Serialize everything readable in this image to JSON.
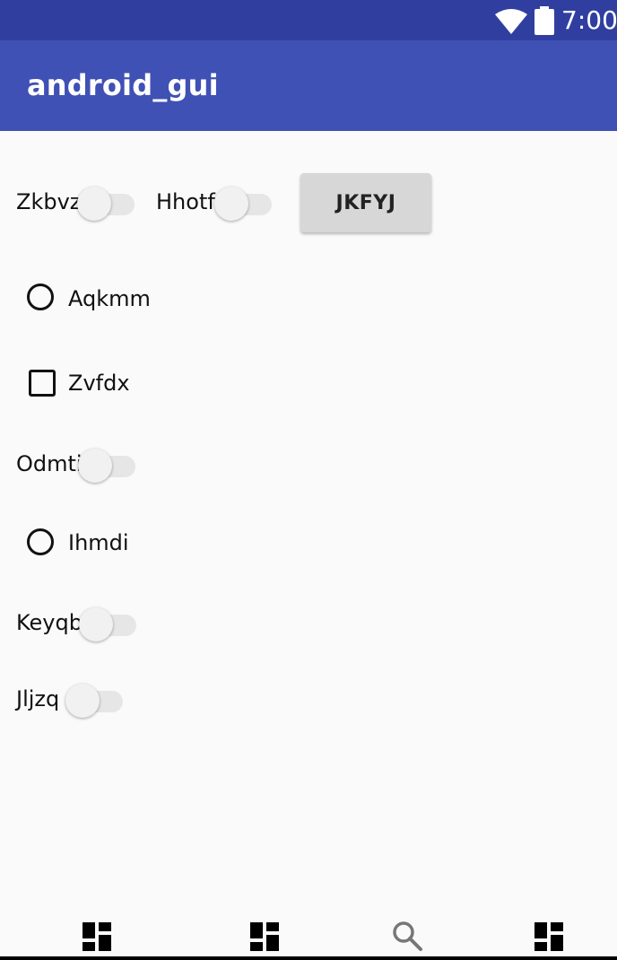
{
  "status_bar": {
    "time": "7:00",
    "icons": [
      "wifi-icon",
      "battery-icon"
    ]
  },
  "app_bar": {
    "title": "android_gui"
  },
  "controls": {
    "switch_zkbvz": {
      "label": "Zkbvz",
      "checked": false
    },
    "switch_hhotf": {
      "label": "Hhotf",
      "checked": false
    },
    "button_jkfyj": {
      "label": "JKFYJ"
    },
    "radio_aqkmm": {
      "label": "Aqkmm",
      "checked": false
    },
    "checkbox_zvfdx": {
      "label": "Zvfdx",
      "checked": false
    },
    "switch_odmti": {
      "label": "Odmti",
      "checked": false
    },
    "radio_ihmdi": {
      "label": "Ihmdi",
      "checked": false
    },
    "switch_keyqb": {
      "label": "Keyqb",
      "checked": false
    },
    "switch_jljzq": {
      "label": "Jljzq",
      "checked": false
    }
  },
  "bottom_nav": {
    "items": [
      {
        "icon": "dashboard-icon"
      },
      {
        "icon": "dashboard-icon"
      },
      {
        "icon": "search-icon"
      },
      {
        "icon": "dashboard-icon"
      }
    ]
  },
  "colors": {
    "status_bar": "#303f9f",
    "app_bar": "#3f51b5",
    "background": "#fafafa",
    "button": "#d7d7d7"
  }
}
